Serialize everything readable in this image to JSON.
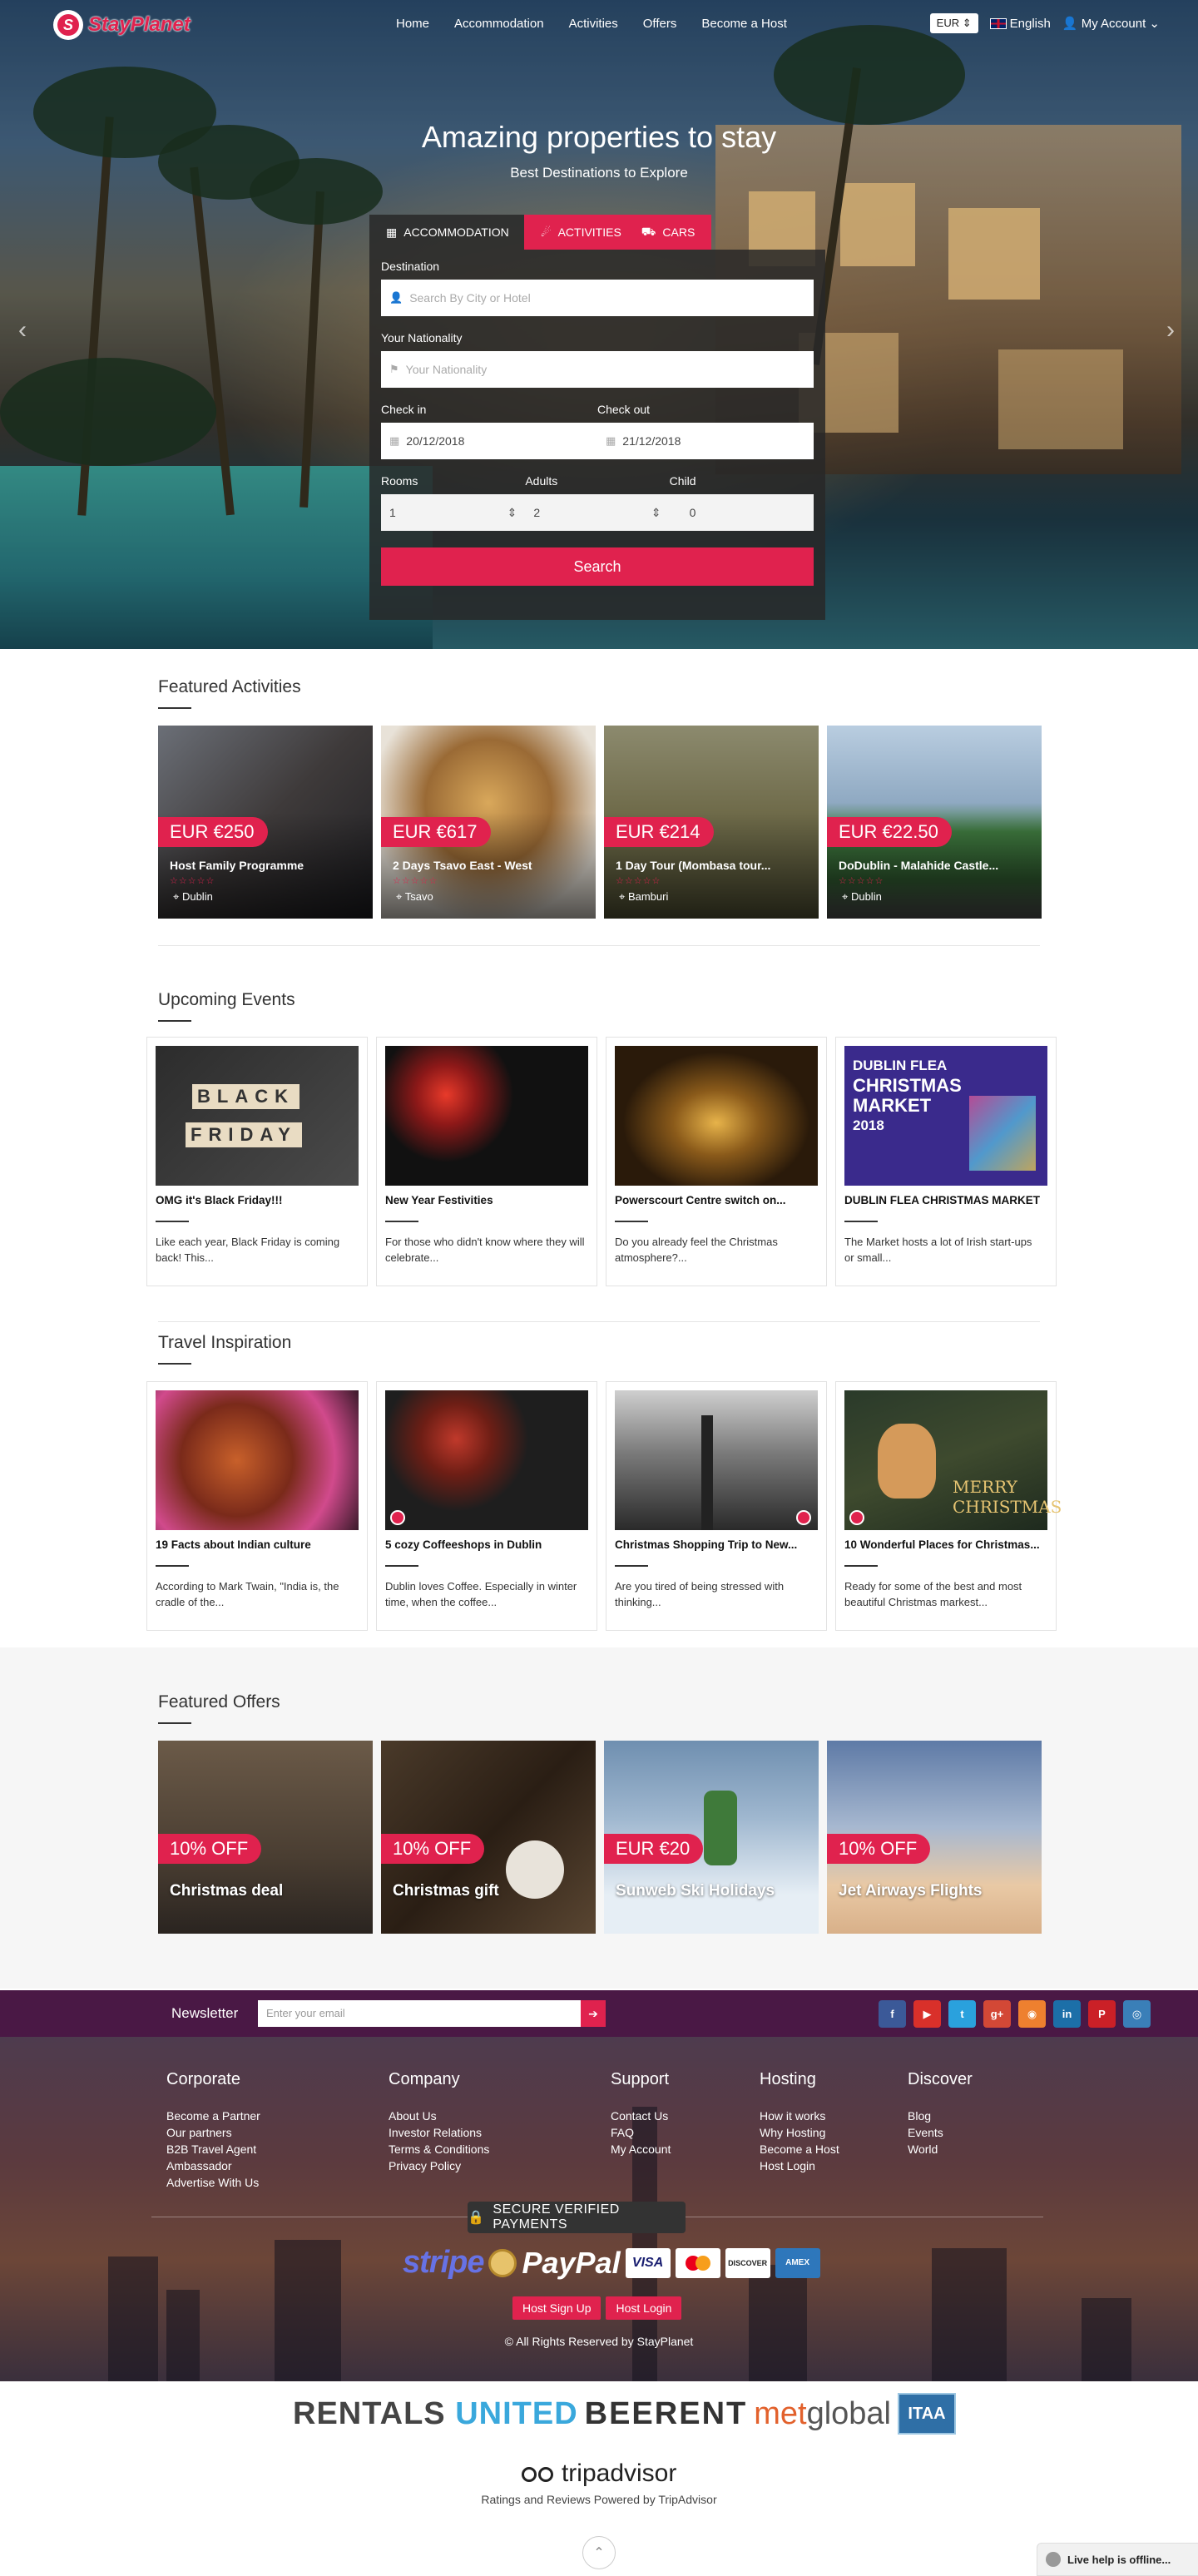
{
  "nav": {
    "logo_text": "StayPlanet",
    "links": [
      "Home",
      "Accommodation",
      "Activities",
      "Offers",
      "Become a Host"
    ],
    "currency": "EUR",
    "language": "English",
    "account": "My Account"
  },
  "hero": {
    "title": "Amazing properties to stay",
    "subtitle": "Best Destinations to Explore",
    "tabs": [
      "ACCOMMODATION",
      "ACTIVITIES",
      "CARS"
    ]
  },
  "search": {
    "destination_label": "Destination",
    "destination_placeholder": "Search By City or Hotel",
    "nationality_label": "Your Nationality",
    "nationality_placeholder": "Your Nationality",
    "checkin_label": "Check in",
    "checkin_value": "20/12/2018",
    "checkout_label": "Check out",
    "checkout_value": "21/12/2018",
    "rooms_label": "Rooms",
    "rooms_value": "1",
    "adults_label": "Adults",
    "adults_value": "2",
    "child_label": "Child",
    "child_value": "0",
    "button": "Search"
  },
  "featured_activities": {
    "title": "Featured Activities",
    "items": [
      {
        "price": "EUR €250",
        "name": "Host Family Programme",
        "location": "Dublin"
      },
      {
        "price": "EUR €617",
        "name": "2 Days Tsavo East - West",
        "location": "Tsavo"
      },
      {
        "price": "EUR €214",
        "name": "1 Day Tour (Mombasa tour...",
        "location": "Bamburi"
      },
      {
        "price": "EUR €22.50",
        "name": "DoDublin - Malahide Castle...",
        "location": "Dublin"
      }
    ],
    "stars": "☆☆☆☆☆"
  },
  "upcoming_events": {
    "title": "Upcoming Events",
    "items": [
      {
        "title": "OMG it's Black Friday!!!",
        "text": "Like each year, Black Friday is coming back! This..."
      },
      {
        "title": "New Year Festivities",
        "text": "For those who didn't know where they will celebrate..."
      },
      {
        "title": "Powerscourt Centre switch on...",
        "text": "Do you already feel the Christmas atmosphere?..."
      },
      {
        "title": "DUBLIN FLEA CHRISTMAS MARKET",
        "text": "The Market hosts a lot of Irish start-ups or small..."
      }
    ],
    "img_text": {
      "black": "BLACK",
      "friday": "FRIDAY",
      "flea_line1": "DUBLIN FLEA",
      "flea_line2": "CHRISTMAS",
      "flea_line3": "MARKET",
      "flea_year": "2018"
    }
  },
  "travel_inspiration": {
    "title": "Travel Inspiration",
    "items": [
      {
        "title": "19 Facts about Indian culture",
        "text": "According to Mark Twain, \"India is, the cradle of the..."
      },
      {
        "title": "5 cozy Coffeeshops in Dublin",
        "text": "Dublin loves Coffee. Especially in winter time, when the coffee..."
      },
      {
        "title": "Christmas Shopping Trip to New...",
        "text": "Are you tired of being stressed with thinking..."
      },
      {
        "title": "10 Wonderful Places for Christmas...",
        "text": "Ready for some of the best and most beautiful Christmas markest..."
      }
    ],
    "merry_line1": "MERRY",
    "merry_line2": "CHRISTMAS"
  },
  "featured_offers": {
    "title": "Featured Offers",
    "items": [
      {
        "tag": "10% OFF",
        "name": "Christmas deal"
      },
      {
        "tag": "10% OFF",
        "name": "Christmas gift"
      },
      {
        "tag": "EUR €20",
        "name": "Sunweb Ski Holidays"
      },
      {
        "tag": "10% OFF",
        "name": "Jet Airways Flights"
      }
    ]
  },
  "newsletter": {
    "label": "Newsletter",
    "placeholder": "Enter your email"
  },
  "socials": [
    {
      "icon": "facebook-icon",
      "glyph": "f",
      "color": "#3b5998"
    },
    {
      "icon": "youtube-icon",
      "glyph": "▶",
      "color": "#d9302a"
    },
    {
      "icon": "twitter-icon",
      "glyph": "t",
      "color": "#2aa1dd"
    },
    {
      "icon": "googleplus-icon",
      "glyph": "g+",
      "color": "#d34836"
    },
    {
      "icon": "rss-icon",
      "glyph": "◉",
      "color": "#ee802f"
    },
    {
      "icon": "linkedin-icon",
      "glyph": "in",
      "color": "#1c6fa8"
    },
    {
      "icon": "pinterest-icon",
      "glyph": "P",
      "color": "#cb2027"
    },
    {
      "icon": "instagram-icon",
      "glyph": "◎",
      "color": "#3a7fb8"
    }
  ],
  "footer": {
    "columns": [
      {
        "title": "Corporate",
        "links": [
          "Become a Partner",
          "Our partners",
          "B2B Travel Agent",
          "Ambassador",
          "Advertise With Us"
        ]
      },
      {
        "title": "Company",
        "links": [
          "About Us",
          "Investor Relations",
          "Terms & Conditions",
          "Privacy Policy"
        ]
      },
      {
        "title": "Support",
        "links": [
          "Contact Us",
          "FAQ",
          "My Account"
        ]
      },
      {
        "title": "Hosting",
        "links": [
          "How it works",
          "Why Hosting",
          "Become a Host",
          "Host Login"
        ]
      },
      {
        "title": "Discover",
        "links": [
          "Blog",
          "Events",
          "World"
        ]
      }
    ],
    "secure_label": "SECURE VERIFIED PAYMENTS",
    "payment": {
      "stripe": "stripe",
      "paypal": "PayPal",
      "visa": "VISA",
      "discover": "DISCOVER",
      "amex": "AMEX"
    },
    "host_signup": "Host Sign Up",
    "host_login": "Host Login",
    "copyright": "© All Rights Reserved by StayPlanet"
  },
  "partners": {
    "rentals_a": "RENTALS",
    "rentals_b": "UNITED",
    "beerent": "BEERENT",
    "metglobal_a": "met",
    "metglobal_b": "global",
    "itaa": "ITAA",
    "tripadvisor": "tripadvisor",
    "tripadvisor_sub": "Ratings and Reviews Powered by TripAdvisor"
  },
  "live_chat": "Live help is offline..."
}
